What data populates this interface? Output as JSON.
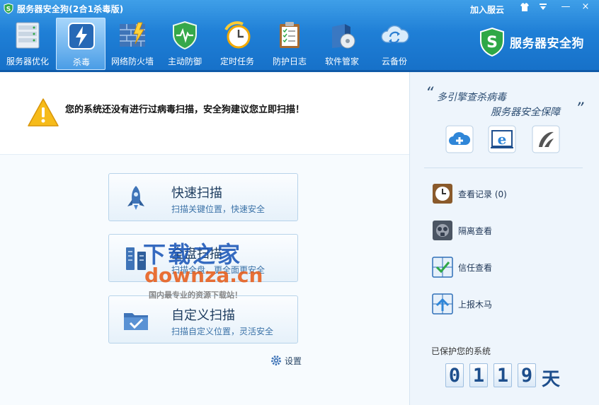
{
  "window": {
    "title": "服务器安全狗(2合1杀毒版)",
    "join_link": "加入服云",
    "controls": {
      "skin": "skin-icon",
      "menu": "menu-icon",
      "minimize": "—",
      "close": "×"
    }
  },
  "tabs": [
    {
      "label": "服务器优化",
      "icon": "server-rack-icon"
    },
    {
      "label": "杀毒",
      "icon": "lightning-shield-icon",
      "active": true
    },
    {
      "label": "网络防火墙",
      "icon": "firewall-icon"
    },
    {
      "label": "主动防御",
      "icon": "defense-shield-icon"
    },
    {
      "label": "定时任务",
      "icon": "clock-icon"
    },
    {
      "label": "防护日志",
      "icon": "clipboard-log-icon"
    },
    {
      "label": "软件管家",
      "icon": "software-box-icon"
    },
    {
      "label": "云备份",
      "icon": "cloud-sync-icon"
    }
  ],
  "brand": {
    "text": "服务器安全狗"
  },
  "main": {
    "warning": "您的系统还没有进行过病毒扫描，安全狗建议您立即扫描！",
    "scans": [
      {
        "title": "快速扫描",
        "desc": "扫描关键位置，快速安全",
        "icon": "rocket-icon"
      },
      {
        "title": "全盘扫描",
        "desc": "扫描全盘，更全面更安全",
        "icon": "disk-stack-icon"
      },
      {
        "title": "自定义扫描",
        "desc": "扫描自定义位置，灵活安全",
        "icon": "folder-check-icon"
      }
    ],
    "settings_label": "设置"
  },
  "watermark": {
    "top": "下载之家",
    "mid": "downza.cn",
    "bottom": "国内最专业的资源下载站！"
  },
  "side": {
    "slogan_line1": "多引擎查杀病毒",
    "slogan_line2": "服务器安全保障",
    "engines": [
      "cloud-engine-icon",
      "ie-engine-icon",
      "avira-engine-icon"
    ],
    "items": [
      {
        "label": "查看记录 (0)",
        "icon": "record-clock-icon"
      },
      {
        "label": "隔离查看",
        "icon": "biohazard-mask-icon"
      },
      {
        "label": "信任查看",
        "icon": "trust-check-icon"
      },
      {
        "label": "上报木马",
        "icon": "report-upload-icon"
      }
    ],
    "protect_label": "已保护您的系统",
    "days_digits": [
      "0",
      "1",
      "1",
      "9"
    ],
    "days_unit": "天"
  },
  "colors": {
    "header": "#1f7fd6",
    "accent": "#1d4e8c",
    "warning": "#f4b400"
  }
}
